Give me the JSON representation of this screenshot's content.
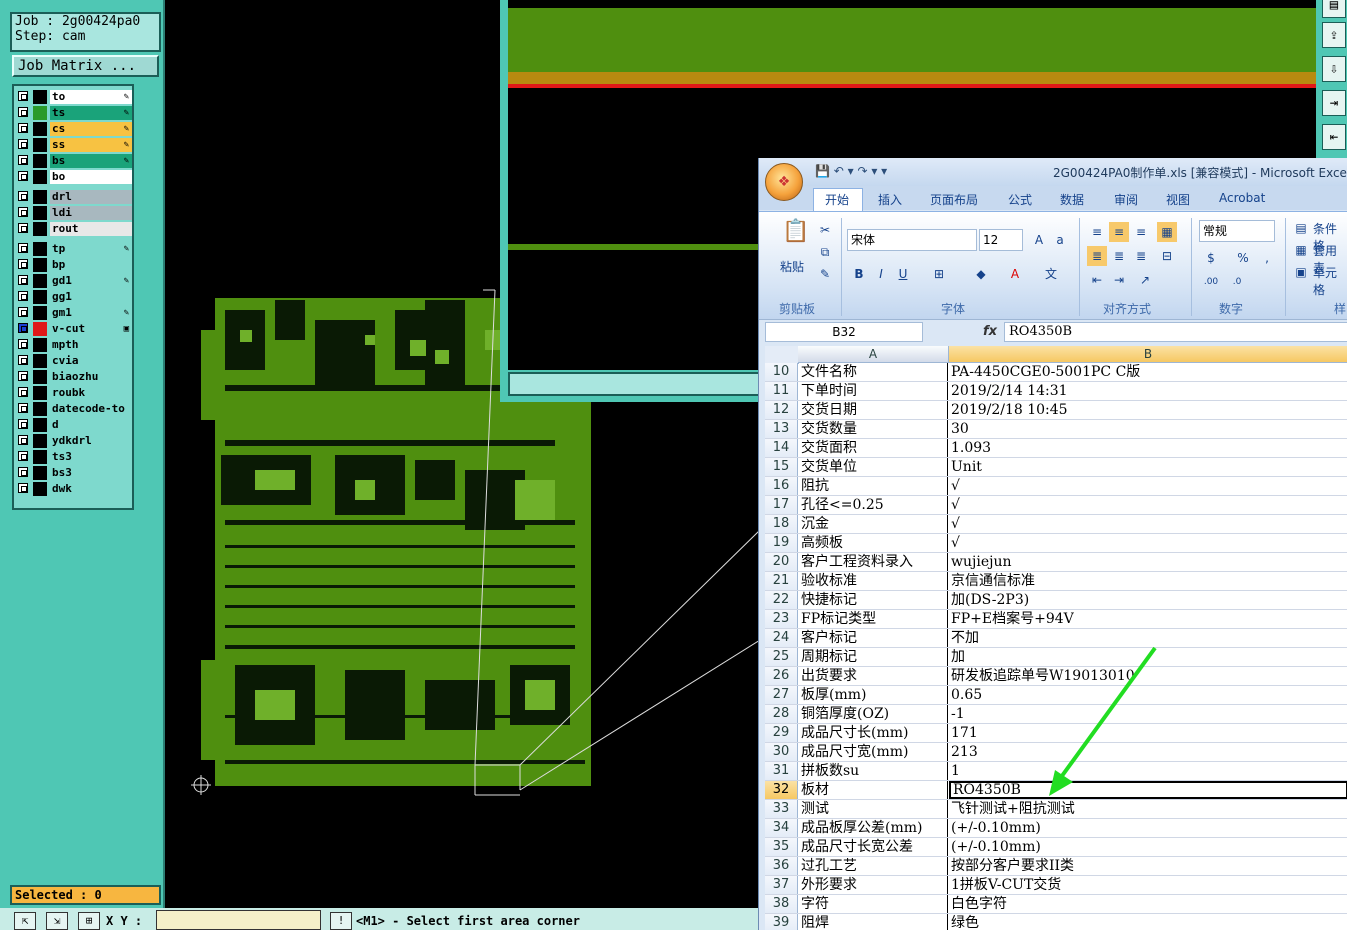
{
  "cam": {
    "job_line": "Job : 2g00424pa0",
    "step_line": "Step: cam",
    "job_matrix_label": "Job Matrix ...",
    "layers": [
      {
        "name": "to",
        "color": "#ffffff",
        "swatch": "#000000",
        "edit": "✎"
      },
      {
        "name": "ts",
        "color": "#1aa37a",
        "swatch": "#2a9a2a",
        "edit": "✎"
      },
      {
        "name": "cs",
        "color": "#f7c242",
        "swatch": "#000000",
        "edit": "✎"
      },
      {
        "name": "ss",
        "color": "#f7c242",
        "swatch": "#000000",
        "edit": "✎"
      },
      {
        "name": "bs",
        "color": "#1aa37a",
        "swatch": "#000000",
        "edit": "✎"
      },
      {
        "name": "bo",
        "color": "#ffffff",
        "swatch": "#000000",
        "edit": ""
      },
      {
        "name": "drl",
        "color": "#a8b8bf",
        "swatch": "#000000",
        "edit": ""
      },
      {
        "name": "ldi",
        "color": "#a8b8bf",
        "swatch": "#000000",
        "edit": ""
      },
      {
        "name": "rout",
        "color": "#e8e8e8",
        "swatch": "#000000",
        "edit": ""
      },
      {
        "name": "tp",
        "color": "#7ed9cd",
        "swatch": "#000000",
        "edit": "✎"
      },
      {
        "name": "bp",
        "color": "#7ed9cd",
        "swatch": "#000000",
        "edit": ""
      },
      {
        "name": "gd1",
        "color": "#7ed9cd",
        "swatch": "#000000",
        "edit": "✎"
      },
      {
        "name": "gg1",
        "color": "#7ed9cd",
        "swatch": "#000000",
        "edit": ""
      },
      {
        "name": "gm1",
        "color": "#7ed9cd",
        "swatch": "#000000",
        "edit": "✎"
      },
      {
        "name": "v-cut",
        "color": "#7ed9cd",
        "swatch": "#e01818",
        "edit": "▣"
      },
      {
        "name": "mpth",
        "color": "#7ed9cd",
        "swatch": "#000000",
        "edit": ""
      },
      {
        "name": "cvia",
        "color": "#7ed9cd",
        "swatch": "#000000",
        "edit": ""
      },
      {
        "name": "biaozhu",
        "color": "#7ed9cd",
        "swatch": "#000000",
        "edit": ""
      },
      {
        "name": "roubk",
        "color": "#7ed9cd",
        "swatch": "#000000",
        "edit": ""
      },
      {
        "name": "datecode-to",
        "color": "#7ed9cd",
        "swatch": "#000000",
        "edit": ""
      },
      {
        "name": "d",
        "color": "#7ed9cd",
        "swatch": "#000000",
        "edit": ""
      },
      {
        "name": "ydkdrl",
        "color": "#7ed9cd",
        "swatch": "#000000",
        "edit": ""
      },
      {
        "name": "ts3",
        "color": "#7ed9cd",
        "swatch": "#000000",
        "edit": ""
      },
      {
        "name": "bs3",
        "color": "#7ed9cd",
        "swatch": "#000000",
        "edit": ""
      },
      {
        "name": "dwk",
        "color": "#7ed9cd",
        "swatch": "#000000",
        "edit": ""
      }
    ],
    "selected_label": "Selected : 0",
    "xy_label": "X Y :",
    "status_message": "<M1> - Select first area corner",
    "pcb_color": "#4f8f0f"
  },
  "excel": {
    "title": "2G00424PA0制作单.xls  [兼容模式] - Microsoft Excel",
    "office_glyph": "❖",
    "qat_icons": "💾 ↶ ▾ ↷ ▾ ▾",
    "tabs": [
      "开始",
      "插入",
      "页面布局",
      "公式",
      "数据",
      "审阅",
      "视图",
      "Acrobat"
    ],
    "font_name": "宋体",
    "font_size": "12",
    "number_format": "常规",
    "paste_label": "粘贴",
    "side_cmds": [
      "条件格",
      "套用表",
      "单元格"
    ],
    "group_labels": [
      "剪贴板",
      "字体",
      "对齐方式",
      "数字",
      "样"
    ],
    "name_box": "B32",
    "fx": "fx",
    "formula_value": "RO4350B",
    "col_a": "A",
    "col_b": "B",
    "rows": [
      {
        "n": "10",
        "a": "文件名称",
        "b": "PA-4450CGE0-5001PC C版"
      },
      {
        "n": "11",
        "a": "下单时间",
        "b": "2019/2/14 14:31"
      },
      {
        "n": "12",
        "a": "交货日期",
        "b": "2019/2/18 10:45"
      },
      {
        "n": "13",
        "a": "交货数量",
        "b": "30"
      },
      {
        "n": "14",
        "a": "交货面积",
        "b": "1.093"
      },
      {
        "n": "15",
        "a": "交货单位",
        "b": "Unit"
      },
      {
        "n": "16",
        "a": "阻抗",
        "b": "√"
      },
      {
        "n": "17",
        "a": "孔径<=0.25",
        "b": "√"
      },
      {
        "n": "18",
        "a": "沉金",
        "b": "√"
      },
      {
        "n": "19",
        "a": "高频板",
        "b": "√"
      },
      {
        "n": "20",
        "a": "客户工程资料录入",
        "b": "wujiejun"
      },
      {
        "n": "21",
        "a": "验收标准",
        "b": "京信通信标准"
      },
      {
        "n": "22",
        "a": "快捷标记",
        "b": "加(DS-2P3)"
      },
      {
        "n": "23",
        "a": "FP标记类型",
        "b": "FP+E档案号+94V"
      },
      {
        "n": "24",
        "a": "客户标记",
        "b": "不加"
      },
      {
        "n": "25",
        "a": "周期标记",
        "b": "加"
      },
      {
        "n": "26",
        "a": "出货要求",
        "b": "研发板追踪单号W19013010"
      },
      {
        "n": "27",
        "a": "板厚(mm)",
        "b": "0.65"
      },
      {
        "n": "28",
        "a": "铜箔厚度(OZ)",
        "b": "-1"
      },
      {
        "n": "29",
        "a": "成品尺寸长(mm)",
        "b": "171"
      },
      {
        "n": "30",
        "a": "成品尺寸宽(mm)",
        "b": "213"
      },
      {
        "n": "31",
        "a": "拼板数su",
        "b": "1"
      },
      {
        "n": "32",
        "a": "板材",
        "b": "RO4350B"
      },
      {
        "n": "33",
        "a": "测试",
        "b": "飞针测试+阻抗测试"
      },
      {
        "n": "34",
        "a": "成品板厚公差(mm)",
        "b": "(+/-0.10mm)"
      },
      {
        "n": "35",
        "a": "成品尺寸长宽公差",
        "b": "(+/-0.10mm)"
      },
      {
        "n": "36",
        "a": "过孔工艺",
        "b": "按部分客户要求II类"
      },
      {
        "n": "37",
        "a": "外形要求",
        "b": "1拼板V-CUT交货"
      },
      {
        "n": "38",
        "a": "字符",
        "b": "白色字符"
      },
      {
        "n": "39",
        "a": "阻焊",
        "b": "绿色"
      }
    ],
    "selected_row": "32",
    "arrow_color": "#22dd22"
  }
}
